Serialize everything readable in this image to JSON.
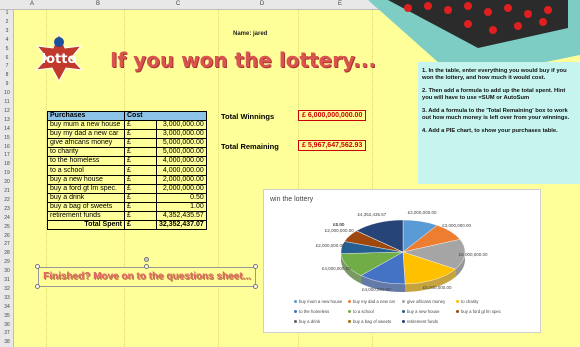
{
  "columns": [
    "A",
    "B",
    "C",
    "D",
    "E"
  ],
  "rows": [
    "1",
    "2",
    "3",
    "4",
    "5",
    "6",
    "7",
    "8",
    "9",
    "10",
    "11",
    "12",
    "13",
    "14",
    "15",
    "16",
    "17",
    "18",
    "19",
    "20",
    "21",
    "22",
    "23",
    "24",
    "25",
    "26",
    "27",
    "28",
    "29",
    "30",
    "31",
    "32",
    "33",
    "34",
    "35",
    "36",
    "37",
    "38"
  ],
  "name_label": "Name: jared",
  "logo_text": "lotto",
  "title": "If you won the lottery...",
  "purchases": {
    "header_item": "Purchases",
    "header_cost": "Cost",
    "currency": "£",
    "rows": [
      {
        "item": "buy mum a new house",
        "amount": "3,000,000.00"
      },
      {
        "item": "buy my dad a new car",
        "amount": "3,000,000.00"
      },
      {
        "item": "give africans money",
        "amount": "5,000,000.00"
      },
      {
        "item": "to charity",
        "amount": "5,000,000.00"
      },
      {
        "item": "to the homeless",
        "amount": "4,000,000.00"
      },
      {
        "item": "to a school",
        "amount": "4,000,000.00"
      },
      {
        "item": "buy a new house",
        "amount": "2,000,000.00"
      },
      {
        "item": "buy a ford gt lm spec.",
        "amount": "2,000,000.00"
      },
      {
        "item": "buy a drink",
        "amount": "0.50"
      },
      {
        "item": "buy a bag of sweets",
        "amount": "1.00"
      },
      {
        "item": "retirement funds",
        "amount": "4,352,435.57"
      }
    ],
    "total_label": "Total Spent",
    "total_currency": "£",
    "total_value": "32,352,437.07"
  },
  "winnings": {
    "label": "Total Winnings",
    "value": "£  6,000,000,000.00"
  },
  "remaining": {
    "label": "Total Remaining",
    "value": "£  5,967,647,562.93"
  },
  "instructions": [
    "1. In the table, enter everything you would buy if you won the lottery, and how much it would cost.",
    "2. Then add a formula to add up the total spent. Hint you will have to use =SUM or AutoSum",
    "3. Add a formula to the 'Total Remaining' box to work out how much money is left over from your winnings.",
    "4. Add a PIE chart, to show your purchases table."
  ],
  "finished_text": "Finished? Move on to the questions sheet...",
  "chart_data": {
    "type": "pie",
    "title": "win the lottery",
    "categories": [
      "buy mum a new house",
      "buy my dad a new car",
      "give africans money",
      "to charity",
      "to the homeless",
      "to a school",
      "buy a new house",
      "buy a ford gt lm spec",
      "buy a drink",
      "buy a bag of sweets",
      "retirement funds"
    ],
    "values": [
      3000000,
      3000000,
      5000000,
      5000000,
      4000000,
      4000000,
      2000000,
      2000000,
      0.5,
      1,
      4352435.57
    ],
    "data_labels": [
      "£3,000,000.00",
      "£3,000,000.00",
      "£5,000,000.00",
      "£5,000,000.00",
      "£4,000,000.00",
      "£4,000,000.00",
      "£2,000,000.00",
      "£2,000,000.00",
      "£0.50",
      "£1.00",
      "£4,352,435.57"
    ],
    "colors": [
      "#5b9bd5",
      "#ed7d31",
      "#a5a5a5",
      "#ffc000",
      "#4472c4",
      "#70ad47",
      "#255e91",
      "#9e480e",
      "#636363",
      "#997300",
      "#264478"
    ],
    "legend_position": "bottom"
  }
}
